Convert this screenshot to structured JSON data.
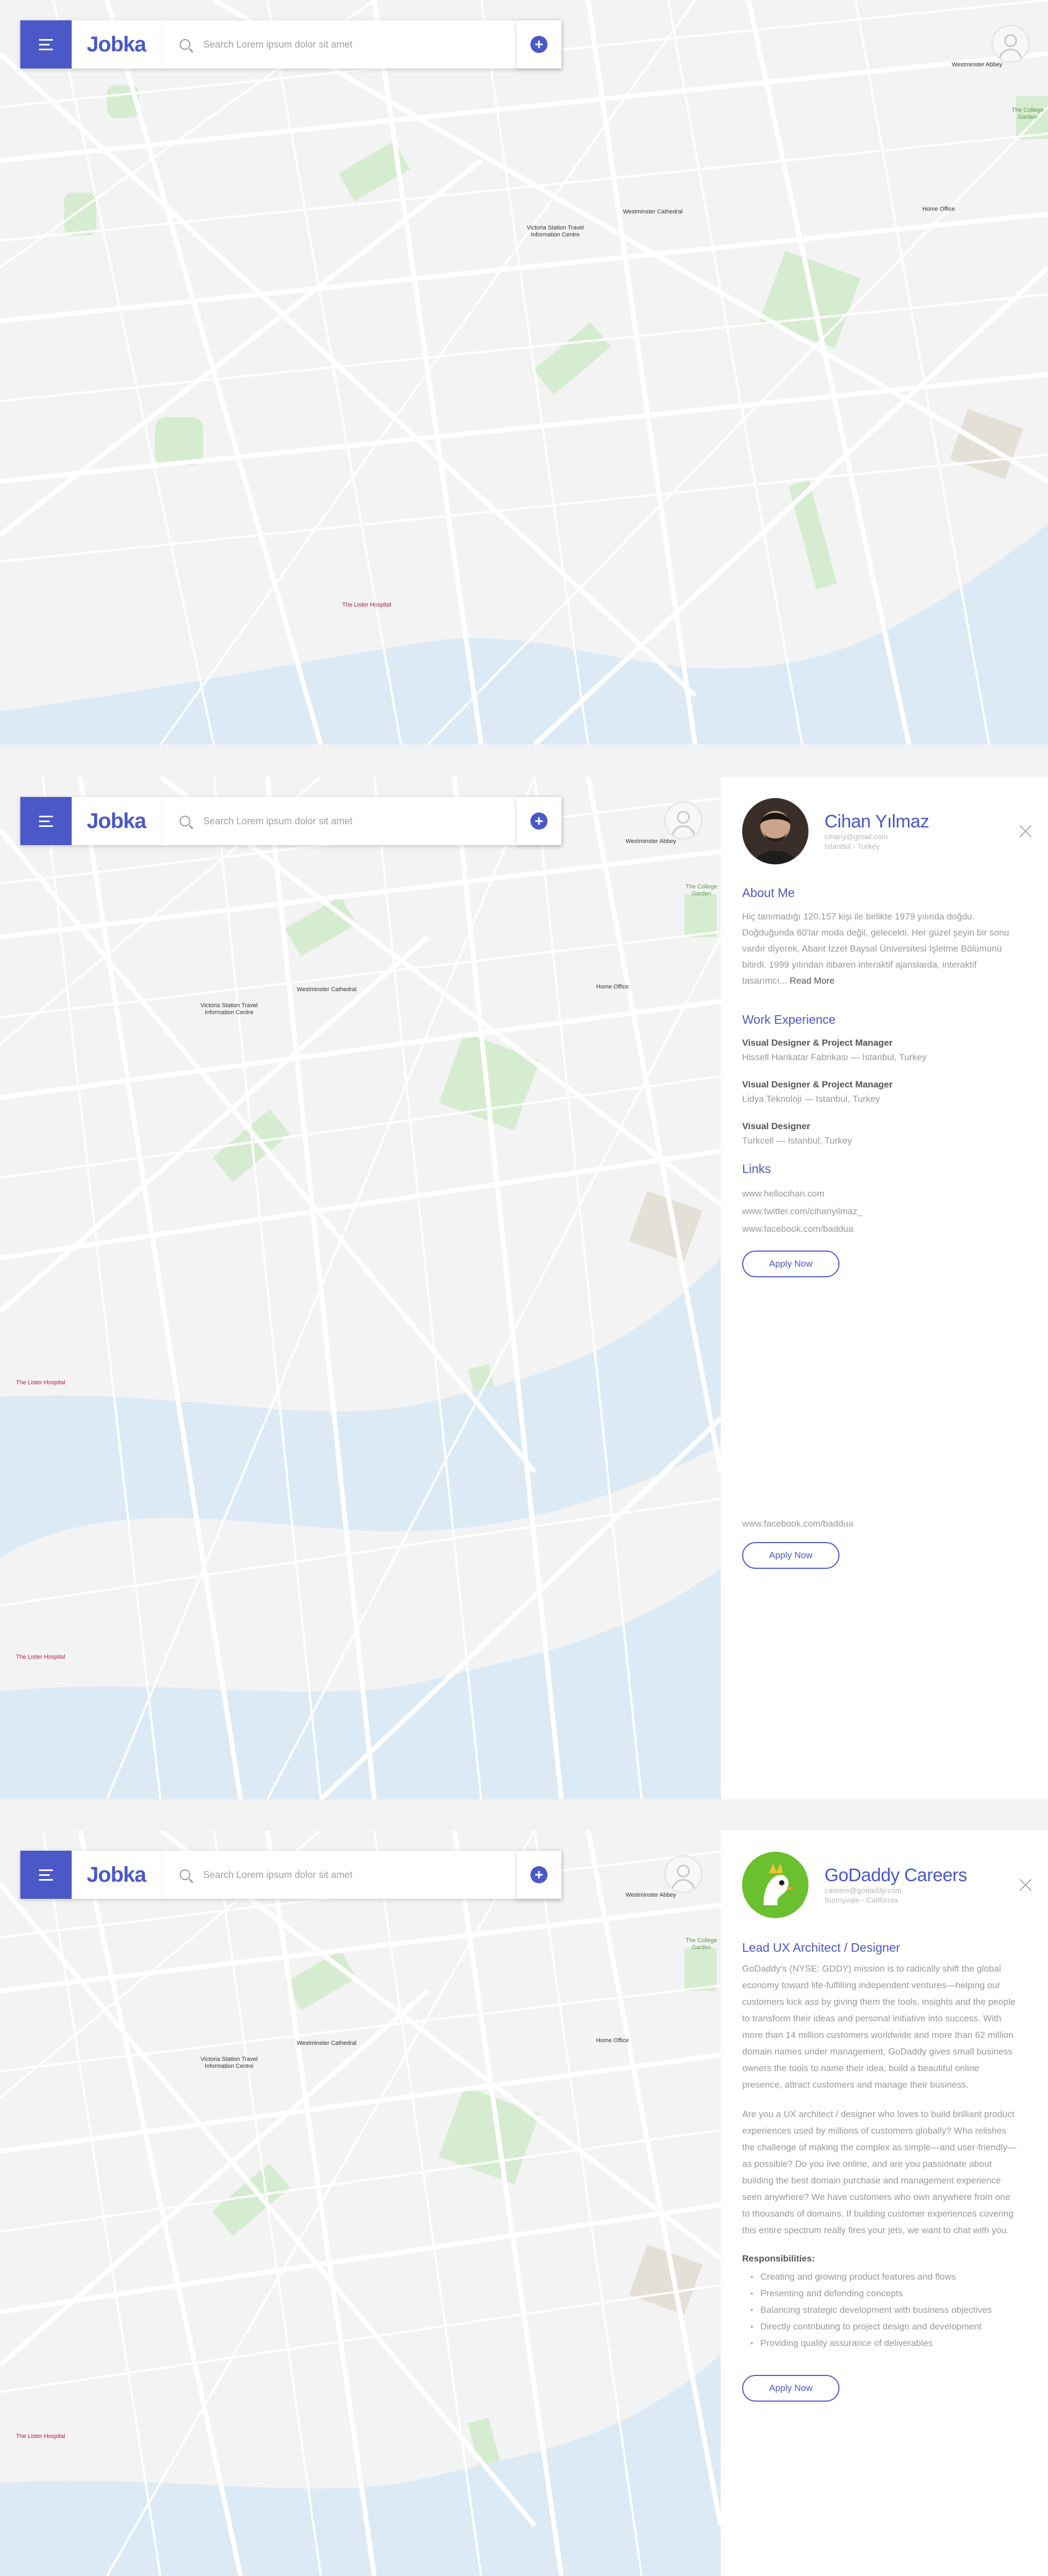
{
  "app": {
    "logo": "Jobka",
    "search_placeholder": "Search Lorem ipsum dolor sit amet",
    "add_label": "+",
    "accent_color": "#4a58c8"
  },
  "icons": [
    "menu-icon",
    "search-icon",
    "add-icon",
    "user-avatar-icon",
    "close-icon"
  ],
  "map": {
    "labels": {
      "westminster_abbey": "Westminster Abbey",
      "westminster_cathedral": "Westminster Cathedral",
      "victoria_station": "Victoria Station Travel\nInformation Centre",
      "home_office": "Home Office",
      "lister_hospital": "The Lister Hospital",
      "college_garden": "The College\nGarden"
    }
  },
  "profile": {
    "name": "Cihan Yılmaz",
    "email": "cihany@gmail.com",
    "location": "Istanbul - Turkey",
    "about_title": "About Me",
    "about_text": "Hiç tanımadığı 120.157 kişi ile birlikte 1979 yılında doğdu. Doğduğunda 60'lar moda değil, gelecekti. Her güzel şeyin bir sonu vardır diyerek, Abant İzzet Baysal Üniversitesi İşletme Bölümünü bitirdi. 1999 yılından itibaren interaktif ajanslarda, interaktif tasarımcı...",
    "read_more": "Read More",
    "work_title": "Work Experience",
    "jobs": [
      {
        "title": "Visual Designer & Project Manager",
        "company": "Hissell Hankatar Fabrikası — Istanbul, Turkey"
      },
      {
        "title": "Visual Designer & Project Manager",
        "company": "Lidya Teknoloji — Istanbul, Turkey"
      },
      {
        "title": "Visual Designer",
        "company": "Turkcell — Istanbul, Turkey"
      }
    ],
    "links_title": "Links",
    "links": [
      "www.hellocihan.com",
      "www.twitter.com/cihanyilmaz_",
      "www.facebook.com/baddua"
    ],
    "apply_label": "Apply Now",
    "overflow_link": "www.facebook.com/baddua"
  },
  "company": {
    "name": "GoDaddy Careers",
    "email": "careers@godaddy.com",
    "location": "Sunnyvale - California",
    "job_title": "Lead UX Architect / Designer",
    "para1": "GoDaddy's (NYSE: GDDY) mission is to radically shift the global economy toward life-fulfilling independent ventures—helping our customers kick ass by giving them the tools, insights and the people to transform their ideas and personal initiative into success. With more than 14 million customers worldwide and more than 62 million domain names under management, GoDaddy gives small business owners the tools to name their idea, build a beautiful online presence, attract customers and manage their business.",
    "para2": "Are you a UX architect / designer who loves to build brilliant product experiences used by millions of customers globally? Who relishes the challenge of making the complex as simple—and user-friendly—as possible? Do you live online, and are you passionate about building the best domain purchase and management experience seen anywhere? We have customers who own anywhere from one to thousands of domains. If building customer experiences covering this entire spectrum really fires your jets, we want to chat with you.",
    "resp_title": "Responsibilities:",
    "responsibilities": [
      "Creating and growing product features and flows",
      "Presenting and defending concepts",
      "Balancing strategic development with business objectives",
      "Directly contributing to project design and development",
      "Providing quality assurance of deliverables"
    ],
    "apply_label": "Apply Now",
    "brand_color": "#6bc030"
  }
}
